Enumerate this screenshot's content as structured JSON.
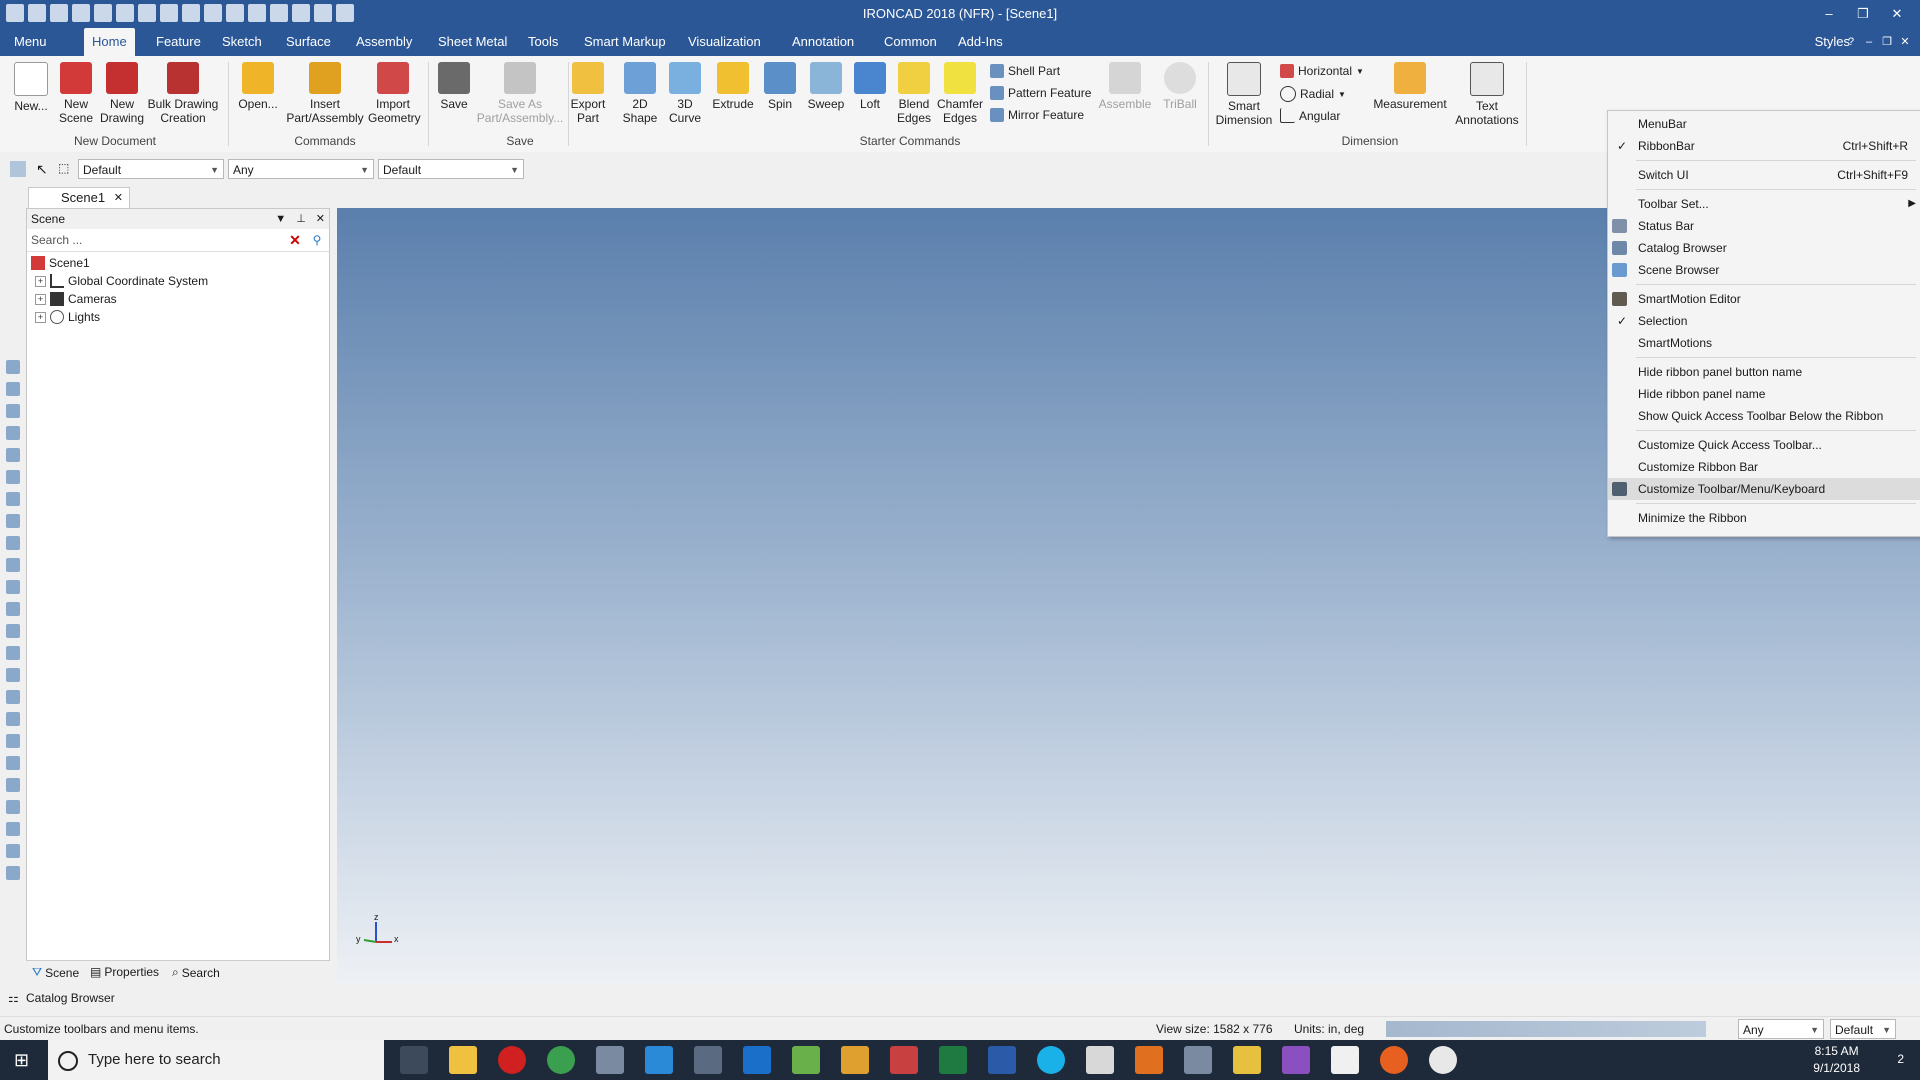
{
  "window": {
    "title": "IRONCAD 2018 (NFR) - [Scene1]"
  },
  "tabs": [
    "Menu",
    "Home",
    "Feature",
    "Sketch",
    "Surface",
    "Assembly",
    "Sheet Metal",
    "Tools",
    "Smart Markup",
    "Visualization",
    "Annotation",
    "Common",
    "Add-Ins"
  ],
  "styles_label": "Styles",
  "ribbon": {
    "new_doc": {
      "new": "New...",
      "new_scene": "New Scene",
      "new_drawing": "New Drawing",
      "bulk_drawing": "Bulk Drawing Creation",
      "group": "New Document"
    },
    "commands": {
      "open": "Open...",
      "insert": "Insert Part/Assembly",
      "import": "Import Geometry",
      "group": "Commands"
    },
    "save": {
      "save": "Save",
      "save_as": "Save As Part/Assembly...",
      "group": "Save"
    },
    "starter": {
      "export": "Export Part",
      "shape2d": "2D Shape",
      "curve3d": "3D Curve",
      "extrude": "Extrude",
      "spin": "Spin",
      "sweep": "Sweep",
      "loft": "Loft",
      "blend": "Blend Edges",
      "chamfer": "Chamfer Edges",
      "shell": "Shell Part",
      "pattern": "Pattern Feature",
      "mirror": "Mirror Feature",
      "assemble": "Assemble",
      "triball": "TriBall",
      "group": "Starter Commands"
    },
    "dimension": {
      "smart": "Smart Dimension",
      "horizontal": "Horizontal",
      "radial": "Radial",
      "angular": "Angular",
      "measurement": "Measurement",
      "text_ann": "Text Annotations",
      "group": "Dimension"
    }
  },
  "toolbar2": {
    "combo1": "Default",
    "combo2": "Any",
    "combo3": "Default"
  },
  "doc_tab": "Scene1",
  "scene_panel": {
    "title": "Scene",
    "search_placeholder": "Search ...",
    "tree": [
      {
        "label": "Scene1"
      },
      {
        "label": "Global Coordinate System"
      },
      {
        "label": "Cameras"
      },
      {
        "label": "Lights"
      }
    ],
    "footer": {
      "scene": "Scene",
      "properties": "Properties",
      "search": "Search"
    }
  },
  "axes": {
    "z": "z",
    "y": "y",
    "x": "x"
  },
  "catalog_bar": "Catalog Browser",
  "status": {
    "message": "Customize toolbars and menu items.",
    "view_size": "View size: 1582 x  776",
    "units": "Units: in, deg",
    "combo_any": "Any",
    "combo_default": "Default"
  },
  "taskbar": {
    "search": "Type here to search",
    "time": "8:15 AM",
    "date": "9/1/2018",
    "notif": "2"
  },
  "context_menu": {
    "items": [
      {
        "label": "MenuBar",
        "shortcut": "",
        "check": ""
      },
      {
        "label": "RibbonBar",
        "shortcut": "Ctrl+Shift+R",
        "check": "✓"
      },
      {
        "label": "Switch UI",
        "shortcut": "Ctrl+Shift+F9",
        "check": ""
      },
      {
        "label": "Toolbar Set...",
        "shortcut": "",
        "check": ""
      },
      {
        "label": "Status Bar",
        "shortcut": "",
        "check": ""
      },
      {
        "label": "Catalog Browser",
        "shortcut": "",
        "check": ""
      },
      {
        "label": "Scene Browser",
        "shortcut": "",
        "check": ""
      },
      {
        "label": "SmartMotion Editor",
        "shortcut": "",
        "check": ""
      },
      {
        "label": "Selection",
        "shortcut": "",
        "check": "✓"
      },
      {
        "label": "SmartMotions",
        "shortcut": "",
        "check": ""
      },
      {
        "label": "Hide ribbon panel button name",
        "shortcut": "",
        "check": ""
      },
      {
        "label": "Hide ribbon panel name",
        "shortcut": "",
        "check": ""
      },
      {
        "label": "Show Quick Access Toolbar Below the Ribbon",
        "shortcut": "",
        "check": ""
      },
      {
        "label": "Customize Quick Access Toolbar...",
        "shortcut": "",
        "check": ""
      },
      {
        "label": "Customize Ribbon Bar",
        "shortcut": "",
        "check": ""
      },
      {
        "label": "Customize Toolbar/Menu/Keyboard",
        "shortcut": "",
        "check": ""
      },
      {
        "label": "Minimize the Ribbon",
        "shortcut": "",
        "check": ""
      }
    ]
  },
  "colors": {
    "accent": "#2b5797",
    "highlight": "#dcdcdc"
  }
}
